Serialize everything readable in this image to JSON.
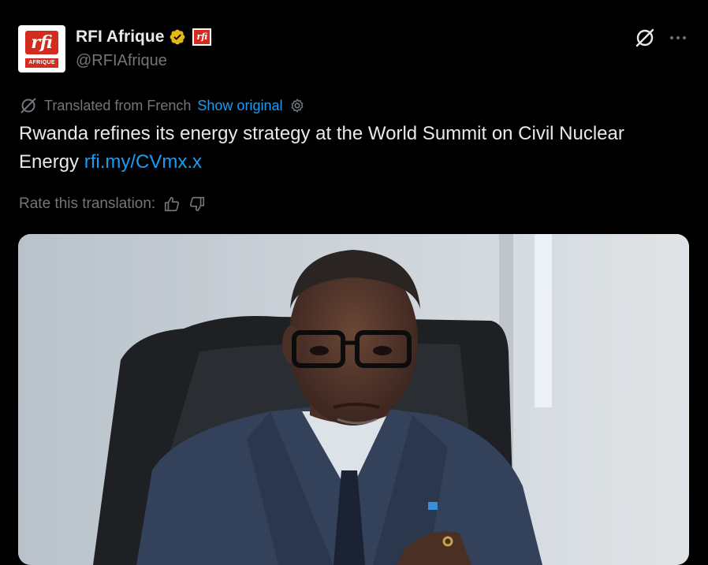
{
  "author": {
    "name": "RFI Afrique",
    "handle": "@RFIAfrique",
    "avatar_logo": "rfi",
    "avatar_sub": "AFRIQUE",
    "affiliate_logo": "rfi"
  },
  "translation": {
    "label": "Translated from French",
    "show_original": "Show original"
  },
  "tweet": {
    "text": "Rwanda refines its energy strategy at the World Summit on Civil Nuclear Energy ",
    "link": "rfi.my/CVmx.x"
  },
  "rating": {
    "label": "Rate this translation:"
  },
  "colors": {
    "accent": "#1d9bf0",
    "brand": "#d52b1e",
    "verified": "#e2b719"
  }
}
